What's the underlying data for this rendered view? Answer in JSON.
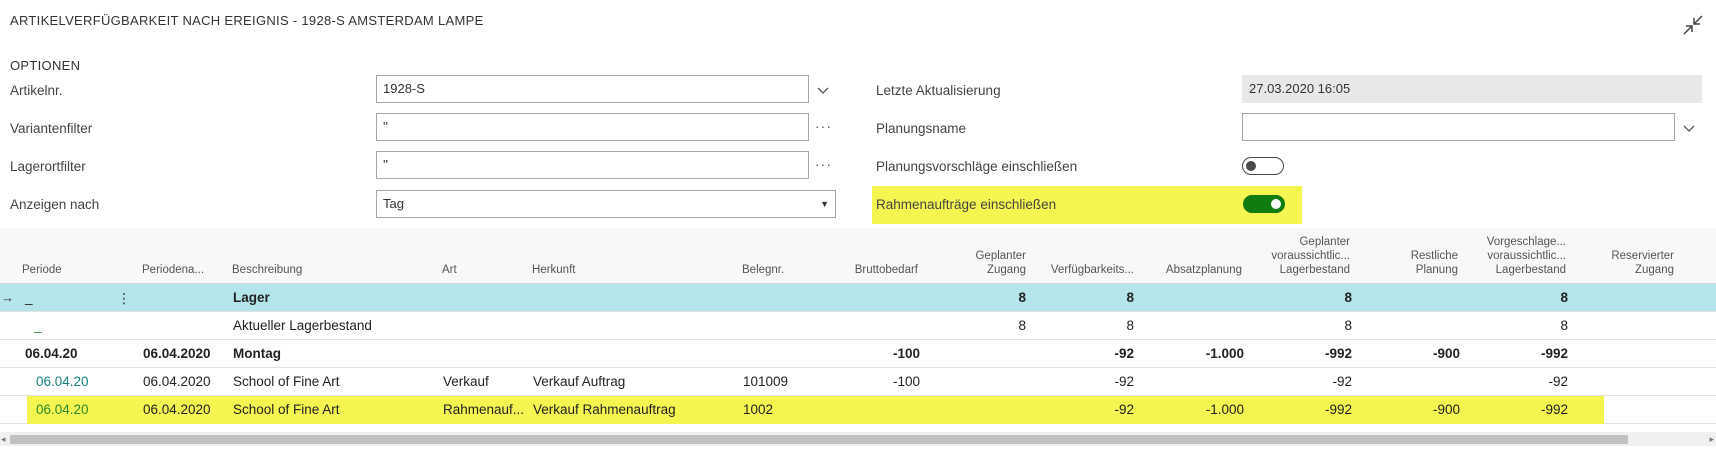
{
  "header": {
    "title": "ARTIKELVERFÜGBARKEIT NACH EREIGNIS - 1928-S AMSTERDAM LAMPE"
  },
  "options": {
    "section_title": "OPTIONEN",
    "item_no_label": "Artikelnr.",
    "item_no_value": "1928-S",
    "variant_filter_label": "Variantenfilter",
    "variant_filter_value": "''",
    "location_filter_label": "Lagerortfilter",
    "location_filter_value": "''",
    "show_by_label": "Anzeigen nach",
    "show_by_value": "Tag",
    "last_updated_label": "Letzte Aktualisierung",
    "last_updated_value": "27.03.2020 16:05",
    "planning_name_label": "Planungsname",
    "planning_name_value": "",
    "include_planning_label": "Planungsvorschläge einschließen",
    "include_planning_on": false,
    "include_blanket_label": "Rahmenaufträge einschließen",
    "include_blanket_on": true,
    "more_glyph": "···",
    "select_arrow": "▼",
    "highlight_color": "#f5f552",
    "toggle_on_color": "#107c10"
  },
  "columns": {
    "periode": "Periode",
    "periodenende": "Periodena...",
    "beschreibung": "Beschreibung",
    "art": "Art",
    "herkunft": "Herkunft",
    "belegnr": "Belegnr.",
    "brutto": "Bruttobedarf",
    "gepl_zugang_1": "Geplanter",
    "gepl_zugang_2": "Zugang",
    "verfueg": "Verfügbarkeits...",
    "absatz": "Absatzplanung",
    "gepl_lager_1": "Geplanter",
    "gepl_lager_2": "voraussichtlic...",
    "gepl_lager_3": "Lagerbestand",
    "rest_1": "Restliche",
    "rest_2": "Planung",
    "vorg_1": "Vorgeschlage...",
    "vorg_2": "voraussichtlic...",
    "vorg_3": "Lagerbestand",
    "reserv_1": "Reservierter",
    "reserv_2": "Zugang"
  },
  "rows": [
    {
      "periode": "_",
      "periodenende": "",
      "beschreibung": "Lager",
      "art": "",
      "herkunft": "",
      "belegnr": "",
      "brutto": "",
      "gepl_zugang": "8",
      "verfueg": "8",
      "absatz": "",
      "gepl_lager": "8",
      "rest": "",
      "vorg": "8",
      "reserv": ""
    },
    {
      "periode": "_",
      "periodenende": "",
      "beschreibung": "Aktueller Lagerbestand",
      "art": "",
      "herkunft": "",
      "belegnr": "",
      "brutto": "",
      "gepl_zugang": "8",
      "verfueg": "8",
      "absatz": "",
      "gepl_lager": "8",
      "rest": "",
      "vorg": "8",
      "reserv": ""
    },
    {
      "periode": "06.04.20",
      "periodenende": "06.04.2020",
      "beschreibung": "Montag",
      "art": "",
      "herkunft": "",
      "belegnr": "",
      "brutto": "-100",
      "gepl_zugang": "",
      "verfueg": "-92",
      "absatz": "-1.000",
      "gepl_lager": "-992",
      "rest": "-900",
      "vorg": "-992",
      "reserv": ""
    },
    {
      "periode": "06.04.20",
      "periodenende": "06.04.2020",
      "beschreibung": "School of Fine Art",
      "art": "Verkauf",
      "herkunft": "Verkauf Auftrag",
      "belegnr": "101009",
      "brutto": "-100",
      "gepl_zugang": "",
      "verfueg": "-92",
      "absatz": "",
      "gepl_lager": "-92",
      "rest": "",
      "vorg": "-92",
      "reserv": ""
    },
    {
      "periode": "06.04.20",
      "periodenende": "06.04.2020",
      "beschreibung": "School of Fine Art",
      "art": "Rahmenauf...",
      "herkunft": "Verkauf Rahmenauftrag",
      "belegnr": "1002",
      "brutto": "",
      "gepl_zugang": "",
      "verfueg": "-92",
      "absatz": "-1.000",
      "gepl_lager": "-992",
      "rest": "-900",
      "vorg": "-992",
      "reserv": ""
    }
  ],
  "grid": {
    "row_arrow": "→",
    "row_menu": "⋮",
    "scroll_left": "◂",
    "scroll_right": "▸"
  }
}
